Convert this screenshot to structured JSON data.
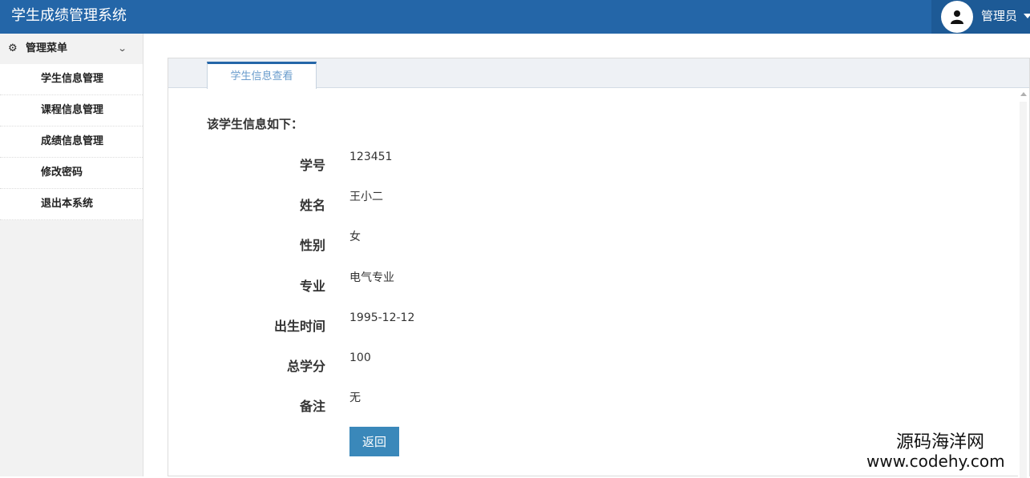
{
  "header": {
    "title": "学生成绩管理系统",
    "user_name": "管理员",
    "avatar_icon": "user-icon"
  },
  "sidebar": {
    "menu_title": "管理菜单",
    "items": [
      {
        "label": "学生信息管理"
      },
      {
        "label": "课程信息管理"
      },
      {
        "label": "成绩信息管理"
      },
      {
        "label": "修改密码"
      },
      {
        "label": "退出本系统"
      }
    ]
  },
  "main": {
    "tab_label": "学生信息查看",
    "section_title": "该学生信息如下：",
    "fields": [
      {
        "label": "学号",
        "value": "123451"
      },
      {
        "label": "姓名",
        "value": "王小二"
      },
      {
        "label": "性别",
        "value": "女"
      },
      {
        "label": "专业",
        "value": "电气专业"
      },
      {
        "label": "出生时间",
        "value": "1995-12-12"
      },
      {
        "label": "总学分",
        "value": "100"
      },
      {
        "label": "备注",
        "value": "无"
      }
    ],
    "back_label": "返回"
  },
  "watermark": {
    "line1": "源码海洋网",
    "line2": "www.codehy.com"
  },
  "colors": {
    "header_bg": "#2466a8",
    "button_bg": "#3a88ba"
  }
}
